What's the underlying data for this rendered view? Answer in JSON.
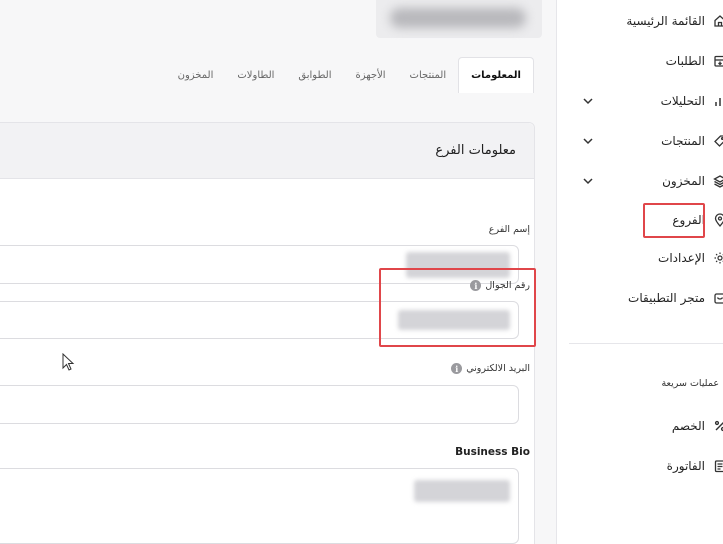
{
  "tabs": [
    {
      "label": "المعلومات",
      "active": true
    },
    {
      "label": "المنتجات",
      "active": false
    },
    {
      "label": "الأجهزة",
      "active": false
    },
    {
      "label": "الطوابق",
      "active": false
    },
    {
      "label": "الطاولات",
      "active": false
    },
    {
      "label": "المخزون",
      "active": false
    }
  ],
  "card": {
    "title": "معلومات الفرع",
    "fields": {
      "branch_name": {
        "label": "إسم الفرع"
      },
      "mobile": {
        "label": "رقم الجوال",
        "info_icon": "i"
      },
      "email": {
        "label": "البريد الالكتروني",
        "info_icon": "i"
      },
      "bio": {
        "label": "Business Bio"
      }
    }
  },
  "sidebar": {
    "items": [
      {
        "label": "القائمة الرئيسية",
        "icon": "home-icon"
      },
      {
        "label": "الطلبات",
        "icon": "orders-icon"
      },
      {
        "label": "التحليلات",
        "icon": "chart-icon",
        "expandable": true
      },
      {
        "label": "المنتجات",
        "icon": "tag-icon",
        "expandable": true
      },
      {
        "label": "المخزون",
        "icon": "layers-icon",
        "expandable": true
      },
      {
        "label": "الفروع",
        "icon": "location-pin-icon",
        "highlighted": true
      },
      {
        "label": "الإعدادات",
        "icon": "gear-icon"
      },
      {
        "label": "متجر التطبيقات",
        "icon": "store-icon"
      }
    ],
    "quick_actions": {
      "title": "عمليات سريعة",
      "items": [
        {
          "label": "الخصم",
          "icon": "percent-icon"
        },
        {
          "label": "الفاتورة",
          "icon": "invoice-icon"
        }
      ]
    }
  },
  "colors": {
    "highlight": "#e0464a",
    "sidebar_bg": "#ffffff",
    "main_bg": "#f7f7f8"
  }
}
